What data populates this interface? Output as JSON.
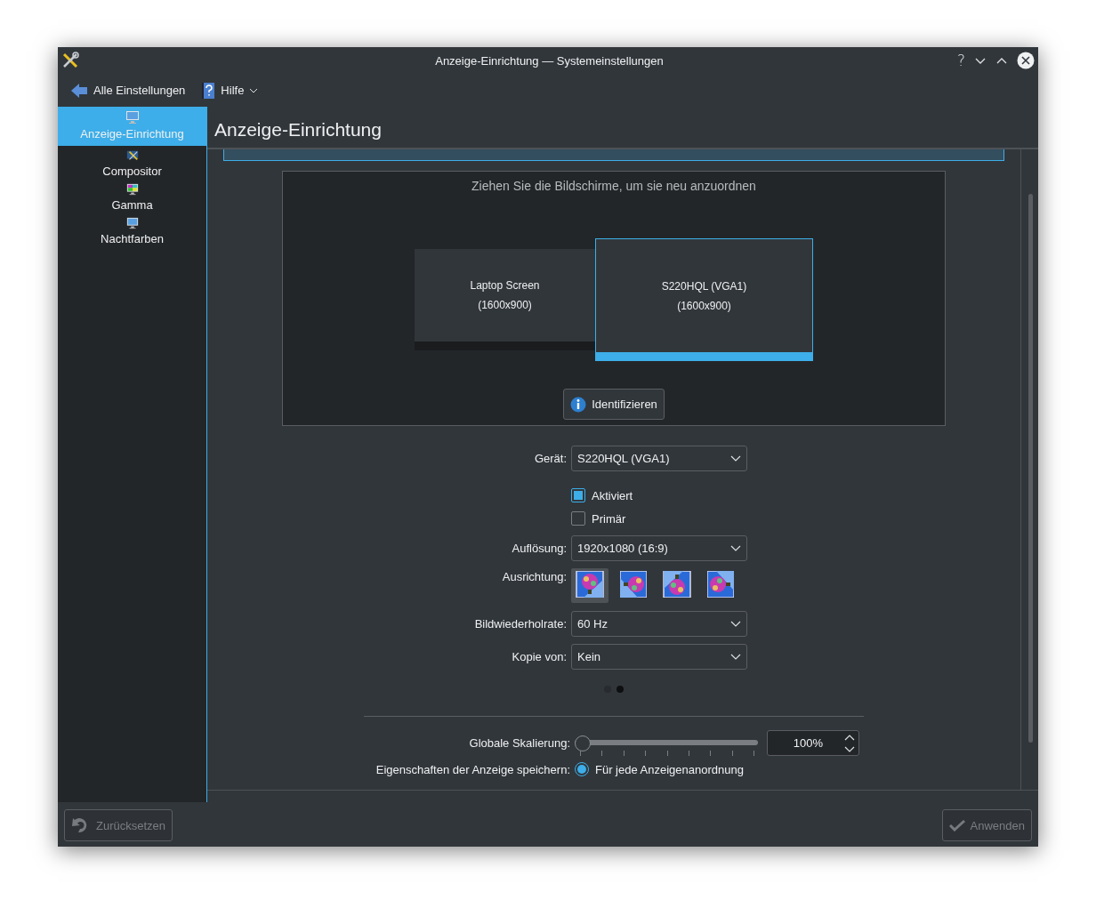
{
  "window": {
    "title": "Anzeige-Einrichtung — Systemeinstellungen",
    "help_glyph": "?"
  },
  "toolbar": {
    "back": "Alle Einstellungen",
    "help": "Hilfe"
  },
  "sidebar": {
    "items": [
      {
        "label": "Anzeige-Einrichtung",
        "kind": "display",
        "selected": true
      },
      {
        "label": "Compositor",
        "kind": "compositor",
        "selected": false
      },
      {
        "label": "Gamma",
        "kind": "gamma",
        "selected": false
      },
      {
        "label": "Nachtfarben",
        "kind": "display",
        "selected": false
      }
    ]
  },
  "page_title": "Anzeige-Einrichtung",
  "arrangement": {
    "hint": "Ziehen Sie die Bildschirme, um sie neu anzuordnen",
    "outputs": [
      {
        "name": "Laptop Screen",
        "mode": "(1600x900)",
        "selected": false
      },
      {
        "name": "S220HQL (VGA1)",
        "mode": "(1600x900)",
        "selected": true
      }
    ],
    "identify": "Identifizieren"
  },
  "form": {
    "device": {
      "label": "Gerät:",
      "value": "S220HQL (VGA1)"
    },
    "checkboxes": [
      {
        "label": "Aktiviert",
        "checked": true
      },
      {
        "label": "Primär",
        "checked": false
      }
    ],
    "resolution": {
      "label": "Auflösung:",
      "value": "1920x1080 (16:9)"
    },
    "orientation": {
      "label": "Ausrichtung:",
      "options": [
        {
          "kind": "normal",
          "selected": true
        },
        {
          "kind": "left",
          "selected": false
        },
        {
          "kind": "inverted",
          "selected": false
        },
        {
          "kind": "right",
          "selected": false
        }
      ]
    },
    "refresh": {
      "label": "Bildwiederholrate:",
      "value": "60 Hz"
    },
    "copy": {
      "label": "Kopie von:",
      "value": "Kein"
    },
    "pages": [
      {
        "selected": false
      },
      {
        "selected": true
      }
    ]
  },
  "scaling": {
    "label": "Globale Skalierung:",
    "level": 0,
    "value": "100%"
  },
  "save": {
    "label": "Eigenschaften der Anzeige speichern:",
    "option": "Für jede Anzeigenanordnung",
    "selected": true
  },
  "footer": {
    "buttons": [
      {
        "label": "Zurücksetzen",
        "kind": "reset",
        "disabled": true
      },
      {
        "label": "Anwenden",
        "kind": "apply",
        "disabled": true
      }
    ]
  }
}
